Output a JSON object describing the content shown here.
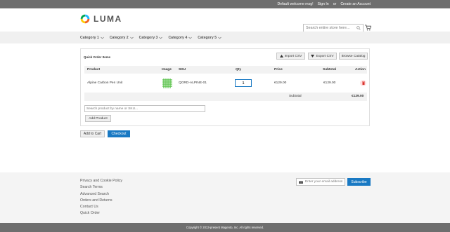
{
  "topbar": {
    "welcome": "Default welcome msg!",
    "sign_in": "Sign In",
    "or": "or",
    "create_account": "Create an Account"
  },
  "header": {
    "logo_text": "LUMA",
    "search_placeholder": "Search entire store here..."
  },
  "nav": {
    "items": [
      "Category 1",
      "Category 2",
      "Category 3",
      "Category 4",
      "Category 5"
    ]
  },
  "quick_order": {
    "title": "Quick Order Items",
    "import_csv": "Import CSV",
    "export_csv": "Export CSV",
    "browse_catalog": "Browse Catalog",
    "columns": [
      "Product",
      "Image",
      "SKU",
      "Qty",
      "Price",
      "Subtotal",
      "Action"
    ],
    "rows": [
      {
        "product": "Alpine Carbon Pen Unit",
        "sku": "QORD-ALPINE-01",
        "qty": "1",
        "price": "€129.00",
        "subtotal": "€129.00"
      }
    ],
    "subtotal_label": "Subtotal",
    "subtotal_value": "€129.00",
    "product_search_placeholder": "Search product by name or SKU...",
    "add_product": "Add Product"
  },
  "actions": {
    "add_to_cart": "Add to Cart",
    "checkout": "Checkout"
  },
  "footer": {
    "links": [
      "Privacy and Cookie Policy",
      "Search Terms",
      "Advanced Search",
      "Orders and Returns",
      "Contact Us",
      "Quick Order"
    ],
    "newsletter_placeholder": "Enter your email address",
    "subscribe": "Subscribe",
    "copyright": "Copyright © 2013-present Magento, Inc. All rights reserved."
  },
  "colors": {
    "primary": "#1979c3",
    "topbar": "#6e6e6e",
    "logo_ring": [
      "#f26322",
      "#ffcb05",
      "#00a651",
      "#1fb6ff"
    ]
  }
}
